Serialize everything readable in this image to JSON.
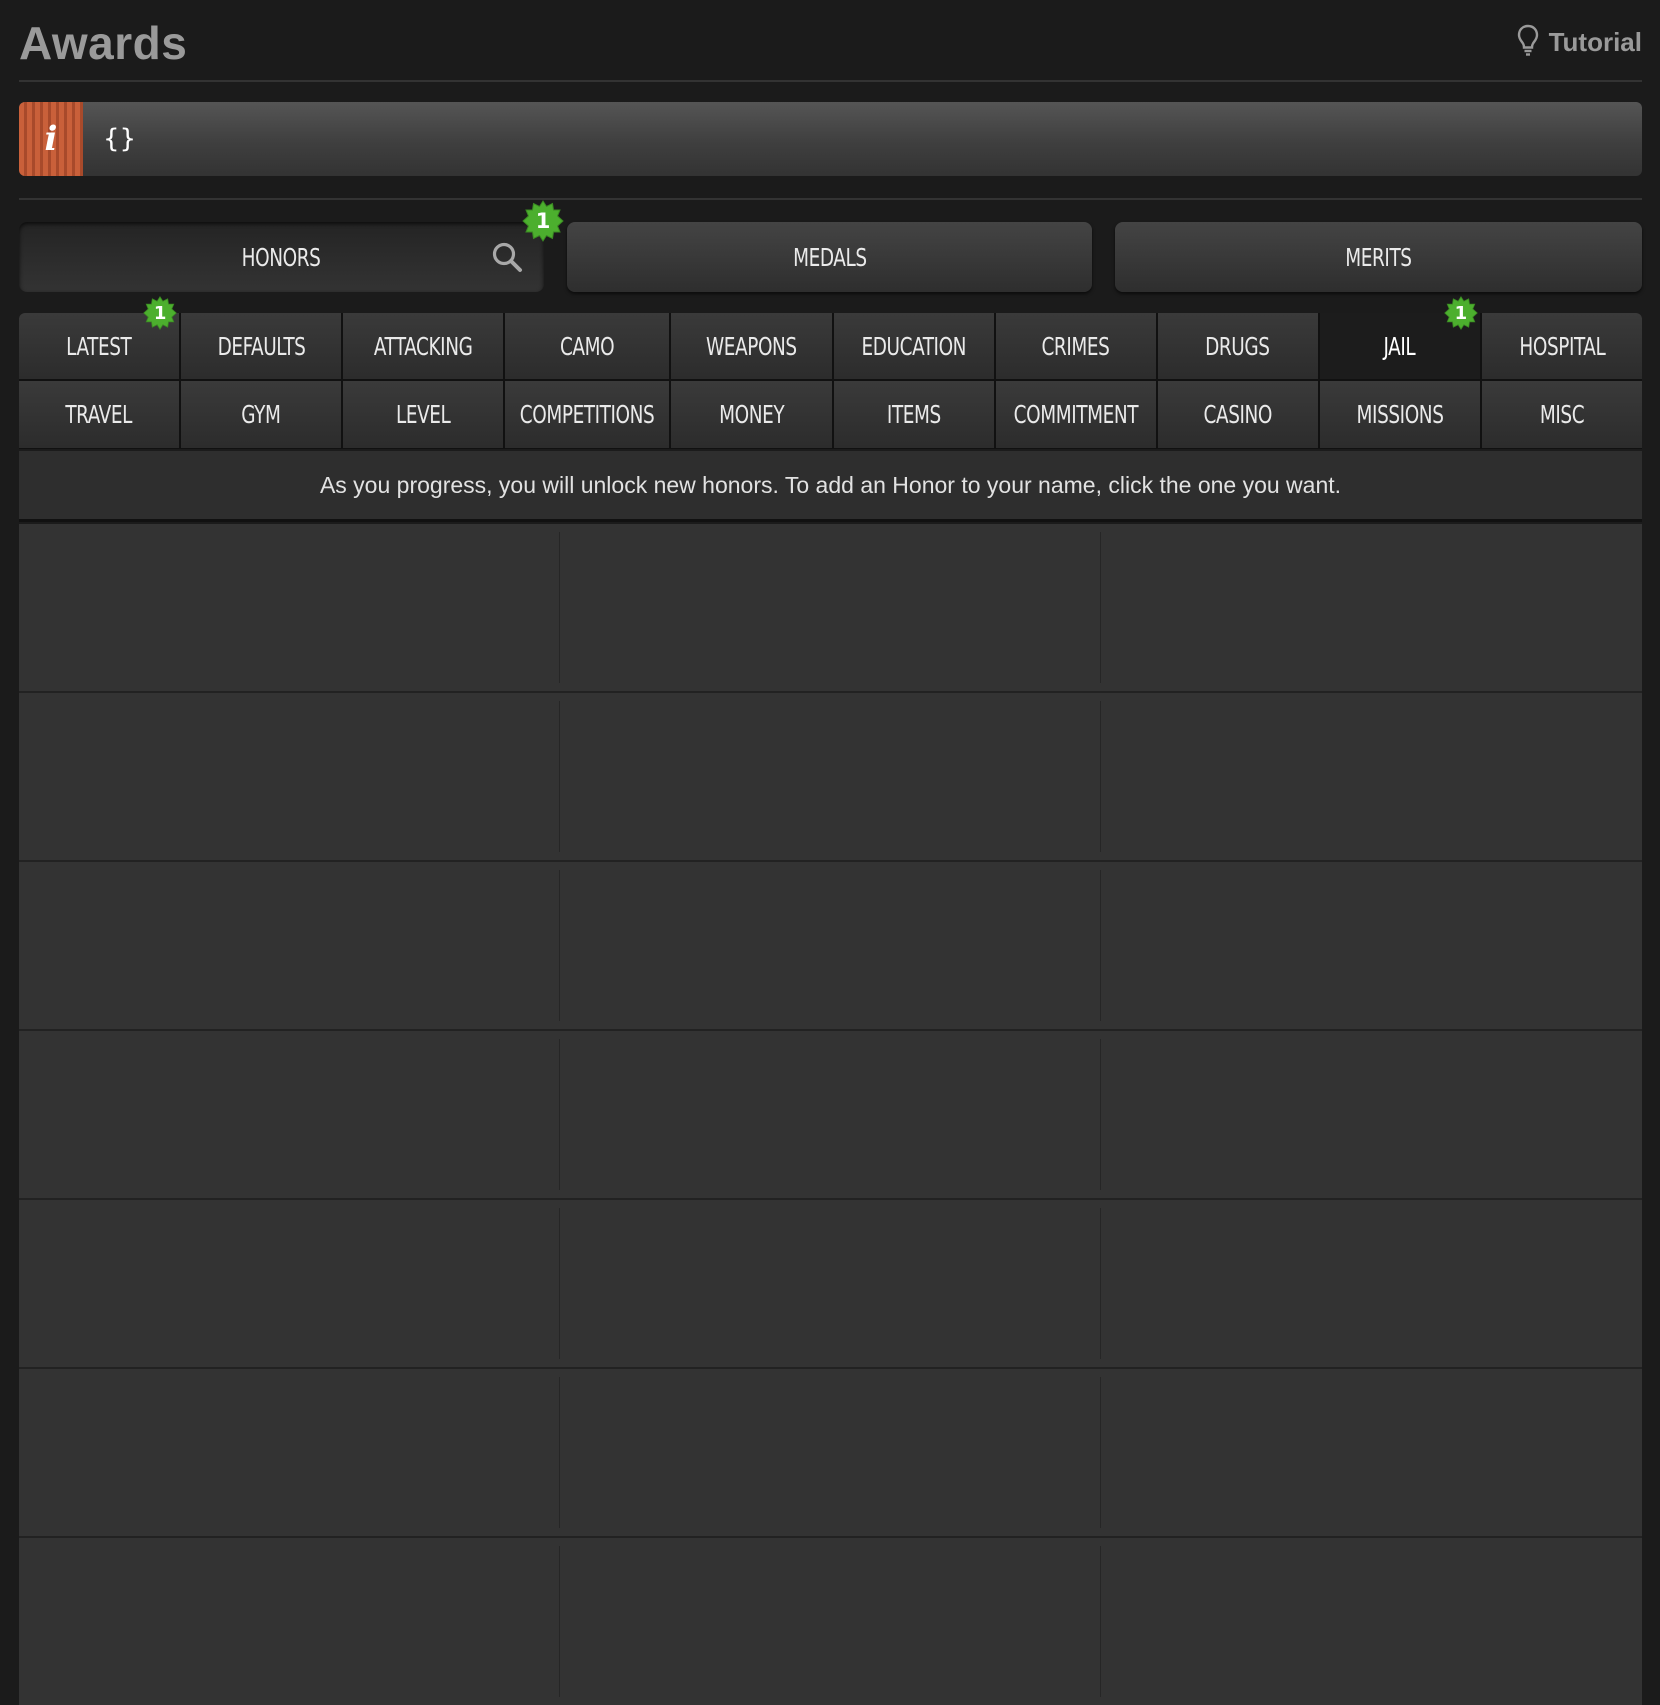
{
  "header": {
    "title": "Awards",
    "tutorial_label": "Tutorial",
    "tutorial_icon": "lightbulb-icon"
  },
  "info_bar": {
    "icon": "info-icon",
    "message": "{}"
  },
  "main_tabs": [
    {
      "label": "HONORS",
      "active": true,
      "has_search": true,
      "badge": "1"
    },
    {
      "label": "MEDALS",
      "active": false
    },
    {
      "label": "MERITS",
      "active": false
    }
  ],
  "categories": [
    {
      "label": "LATEST",
      "badge": "1"
    },
    {
      "label": "DEFAULTS"
    },
    {
      "label": "ATTACKING"
    },
    {
      "label": "CAMO"
    },
    {
      "label": "WEAPONS"
    },
    {
      "label": "EDUCATION"
    },
    {
      "label": "CRIMES"
    },
    {
      "label": "DRUGS"
    },
    {
      "label": "JAIL",
      "active": true,
      "badge": "1"
    },
    {
      "label": "HOSPITAL"
    },
    {
      "label": "TRAVEL"
    },
    {
      "label": "GYM"
    },
    {
      "label": "LEVEL"
    },
    {
      "label": "COMPETITIONS"
    },
    {
      "label": "MONEY"
    },
    {
      "label": "ITEMS"
    },
    {
      "label": "COMMITMENT"
    },
    {
      "label": "CASINO"
    },
    {
      "label": "MISSIONS"
    },
    {
      "label": "MISC"
    }
  ],
  "description": "As you progress, you will unlock new honors. To add an Honor to your name, click the one you want.",
  "colors": {
    "background": "#1b1b1b",
    "badge_green": "#4caf2e",
    "info_orange": "#c9603a"
  }
}
